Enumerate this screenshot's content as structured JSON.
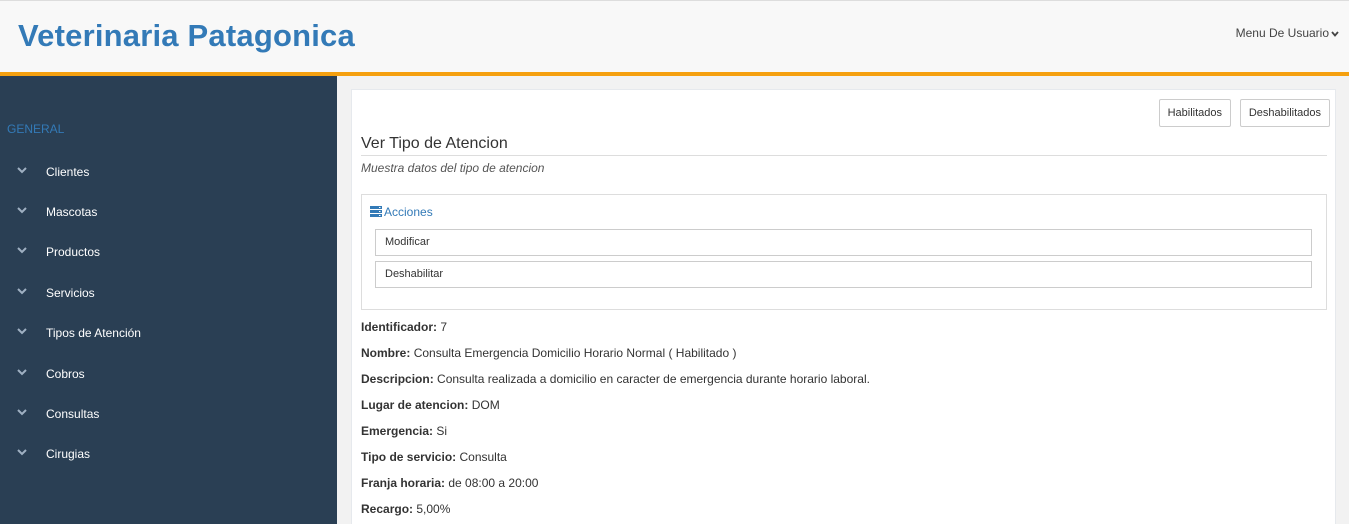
{
  "header": {
    "brand": "Veterinaria Patagonica",
    "user_menu": "Menu De Usuario"
  },
  "sidebar": {
    "section": "GENERAL",
    "items": [
      {
        "label": "Clientes"
      },
      {
        "label": "Mascotas"
      },
      {
        "label": "Productos"
      },
      {
        "label": "Servicios"
      },
      {
        "label": "Tipos de Atención"
      },
      {
        "label": "Cobros"
      },
      {
        "label": "Consultas"
      },
      {
        "label": "Cirugias"
      }
    ]
  },
  "toolbar": {
    "enabled_label": "Habilitados",
    "disabled_label": "Deshabilitados"
  },
  "page": {
    "title": "Ver Tipo de Atencion",
    "subtitle": "Muestra datos del tipo de atencion"
  },
  "actions": {
    "heading": "Acciones",
    "modify_label": "Modificar",
    "disable_label": "Deshabilitar"
  },
  "details": [
    {
      "key": "Identificador:",
      "value": "7"
    },
    {
      "key": "Nombre:",
      "value": "Consulta Emergencia Domicilio Horario Normal ( Habilitado )"
    },
    {
      "key": "Descripcion:",
      "value": "Consulta realizada a domicilio en caracter de emergencia durante horario laboral."
    },
    {
      "key": "Lugar de atencion:",
      "value": "DOM"
    },
    {
      "key": "Emergencia:",
      "value": "Si"
    },
    {
      "key": "Tipo de servicio:",
      "value": "Consulta"
    },
    {
      "key": "Franja horaria:",
      "value": "de 08:00 a 20:00"
    },
    {
      "key": "Recargo:",
      "value": "5,00%"
    }
  ],
  "colors": {
    "accent": "#f5a00f",
    "brand": "#337ab7",
    "sidebar": "#2a3f54"
  }
}
